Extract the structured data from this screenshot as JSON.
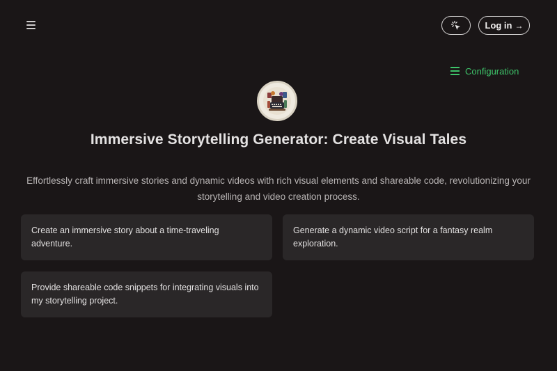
{
  "header": {
    "menu_icon": "hamburger-menu-icon",
    "theme_icon": "cursor-sparkle-icon",
    "login_label": "Log in",
    "login_icon": "arrow-right-icon"
  },
  "config": {
    "label": "Configuration",
    "icon": "list-icon",
    "color": "#3ec46a"
  },
  "hero": {
    "avatar_icon": "storyteller-avatar-icon",
    "title": "Immersive Storytelling Generator: Create Visual Tales",
    "subtitle": "Effortlessly craft immersive stories and dynamic videos with rich visual elements and shareable code, revolutionizing your storytelling and video creation process."
  },
  "suggestions": [
    {
      "text": "Create an immersive story about a time-traveling adventure."
    },
    {
      "text": "Generate a dynamic video script for a fantasy realm exploration."
    },
    {
      "text": "Provide shareable code snippets for integrating visuals into my storytelling project."
    }
  ]
}
